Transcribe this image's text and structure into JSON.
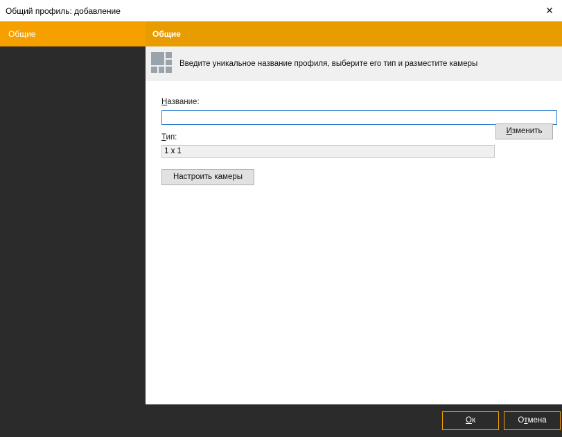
{
  "window": {
    "title": "Общий профиль: добавление",
    "close_symbol": "✕"
  },
  "sidebar": {
    "items": [
      {
        "label": "Общие",
        "selected": true
      }
    ]
  },
  "section": {
    "header": "Общие",
    "info_icon": "grid-layout-icon",
    "info_text": "Введите уникальное название профиля, выберите его тип и разместите камеры"
  },
  "form": {
    "name_label_mnemonic": "Н",
    "name_label_rest": "азвание:",
    "name_value": "",
    "type_label_mnemonic": "Т",
    "type_label_rest": "ип:",
    "type_value": "1 x 1",
    "change_button_mnemonic": "И",
    "change_button_rest": "зменить",
    "configure_cameras_button": "Настроить камеры"
  },
  "footer": {
    "ok_mnemonic": "О",
    "ok_rest": "к",
    "cancel_prefix": "О",
    "cancel_mnemonic": "т",
    "cancel_rest": "мена"
  },
  "colors": {
    "accent": "#f6a000",
    "header_orange": "#e89c00",
    "sidebar_bg": "#2b2b2b",
    "focus_border": "#2f7bd2"
  }
}
